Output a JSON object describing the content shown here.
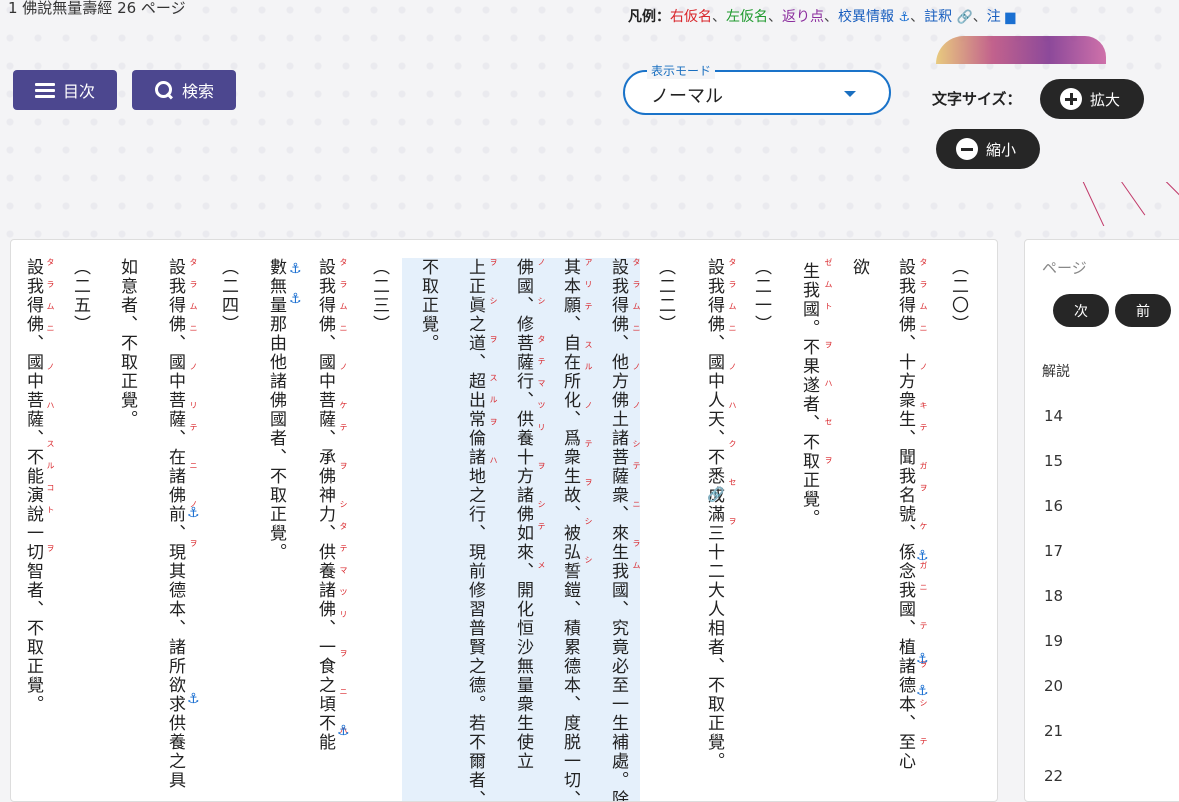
{
  "header": {
    "title": "1 佛說無量壽經 26 ページ",
    "legend_label": "凡例：",
    "legend_right_kana": "右仮名",
    "legend_left_kana": "左仮名",
    "legend_kaeriten": "返り点",
    "legend_kouchou": "校異情報",
    "legend_chushaku": "註釈",
    "legend_chu": "注",
    "legend_sep": "、"
  },
  "toolbar": {
    "toc_label": "目次",
    "search_label": "検索"
  },
  "mode_select": {
    "label": "表示モード",
    "value": "ノーマル"
  },
  "font_size": {
    "label": "文字サイズ：",
    "zoom_in": "拡大",
    "zoom_out": "縮小"
  },
  "columns": [
    "（二〇）",
    "設我得佛、十方衆生、聞我名號、係念我國、植諸德本、至心",
    "欲",
    "生我國。不果遂者、不取正覺。",
    "（二一）",
    "設我得佛、國中人天、不悉成滿三十二大人相者、不取正覺。",
    "（二二）",
    "設我得佛、他方佛土諸菩薩衆、來生我國、究竟必至一生補處。除",
    "其本願、自在所化、爲衆生故、被弘誓鎧、積累德本、度脱一切、",
    "佛國、修菩薩行、供養十方諸佛如來、開化恒沙無量衆生使立",
    "上正眞之道、超出常倫諸地之行、現前修習普賢之德。若不爾者、",
    "不取正覺。",
    "（二三）",
    "設我得佛、國中菩薩、承佛神力、供養諸佛、一食之頃不能",
    "數無量那由他諸佛國者、不取正覺。",
    "（二四）",
    "設我得佛、國中菩薩、在諸佛前、現其德本、諸所欲求供養之具",
    "如意者、不取正覺。",
    "（二五）",
    "設我得佛、國中菩薩、不能演說一切智者、不取正覺。"
  ],
  "ruby": [
    "タラムニ ノ キテ ガヲ ケ ガニ テ ヲ シ テ",
    "ゼムト ヲ ハ セ ヲ",
    "タラムニ ノ ハ ク セ ヲ",
    "タラムニ ノ ノ シテ ニ ラム",
    "アリテ スル ノ テ ヲ シ シ",
    "ノ シ タテマツリ ヲ シテ メ",
    "ヲ シ ヲ スルヲ ハ",
    "タラムニ ノ ケテ ヲ シタテマツリ ヲ ニ ハ",
    "タラムニ ノ リテ ニ ノ ヲ",
    "タラムニ ノ ハ スルコト ヲ"
  ],
  "side_panel": {
    "title": "ページ",
    "next": "次",
    "prev": "前",
    "subtitle": "解説",
    "pages": [
      "14",
      "15",
      "16",
      "17",
      "18",
      "19",
      "20",
      "21",
      "22"
    ]
  },
  "icons": [
    "hamburger-icon",
    "search-icon",
    "plus-icon",
    "minus-icon",
    "anchor-icon",
    "link-icon",
    "document-icon",
    "chevron-down-icon"
  ],
  "colors": {
    "nav_button": "#4c478f",
    "accent_blue": "#1a73c9",
    "right_kana": "#d9252a",
    "left_kana": "#1f9a2e",
    "kaeriten": "#8b2d9e",
    "highlight": "#e5f0fb"
  }
}
